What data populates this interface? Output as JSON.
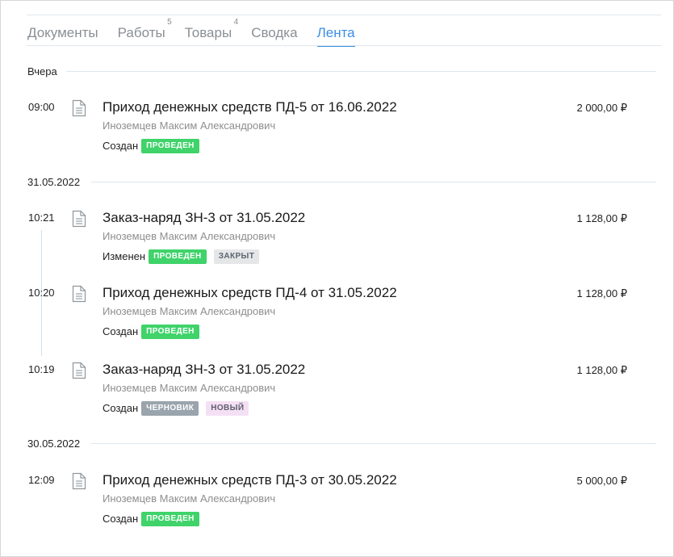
{
  "tabs": [
    {
      "label": "Документы",
      "count": ""
    },
    {
      "label": "Работы",
      "count": "5"
    },
    {
      "label": "Товары",
      "count": "4"
    },
    {
      "label": "Сводка",
      "count": ""
    },
    {
      "label": "Лента",
      "count": ""
    }
  ],
  "active_tab": "Лента",
  "groups": [
    {
      "date": "Вчера",
      "entries": [
        {
          "time": "09:00",
          "title": "Приход денежных средств ПД-5 от 16.06.2022",
          "amount": "2 000,00 ₽",
          "author": "Иноземцев Максим Александрович",
          "action": "Создан",
          "badges": [
            {
              "text": "ПРОВЕДЕН",
              "style": "green"
            }
          ]
        }
      ]
    },
    {
      "date": "31.05.2022",
      "entries": [
        {
          "time": "10:21",
          "title": "Заказ-наряд ЗН-3 от 31.05.2022",
          "amount": "1 128,00 ₽",
          "author": "Иноземцев Максим Александрович",
          "action": "Изменен",
          "badges": [
            {
              "text": "ПРОВЕДЕН",
              "style": "green"
            },
            {
              "text": "ЗАКРЫТ",
              "style": "gray"
            }
          ]
        },
        {
          "time": "10:20",
          "title": "Приход денежных средств ПД-4 от 31.05.2022",
          "amount": "1 128,00 ₽",
          "author": "Иноземцев Максим Александрович",
          "action": "Создан",
          "badges": [
            {
              "text": "ПРОВЕДЕН",
              "style": "green"
            }
          ]
        },
        {
          "time": "10:19",
          "title": "Заказ-наряд ЗН-3 от 31.05.2022",
          "amount": "1 128,00 ₽",
          "author": "Иноземцев Максим Александрович",
          "action": "Создан",
          "badges": [
            {
              "text": "ЧЕРНОВИК",
              "style": "slate"
            },
            {
              "text": "НОВЫЙ",
              "style": "pink"
            }
          ]
        }
      ]
    },
    {
      "date": "30.05.2022",
      "entries": [
        {
          "time": "12:09",
          "title": "Приход денежных средств ПД-3 от 30.05.2022",
          "amount": "5 000,00 ₽",
          "author": "Иноземцев Максим Александрович",
          "action": "Создан",
          "badges": [
            {
              "text": "ПРОВЕДЕН",
              "style": "green"
            }
          ]
        }
      ]
    }
  ],
  "colors": {
    "accent": "#3a8ee6",
    "badge_green": "#3fd36a",
    "badge_gray": "#e4e6e8",
    "badge_slate": "#9aa4ac",
    "badge_pink": "#f4e0f4"
  },
  "icons": {
    "entry_icon": "document-icon"
  }
}
